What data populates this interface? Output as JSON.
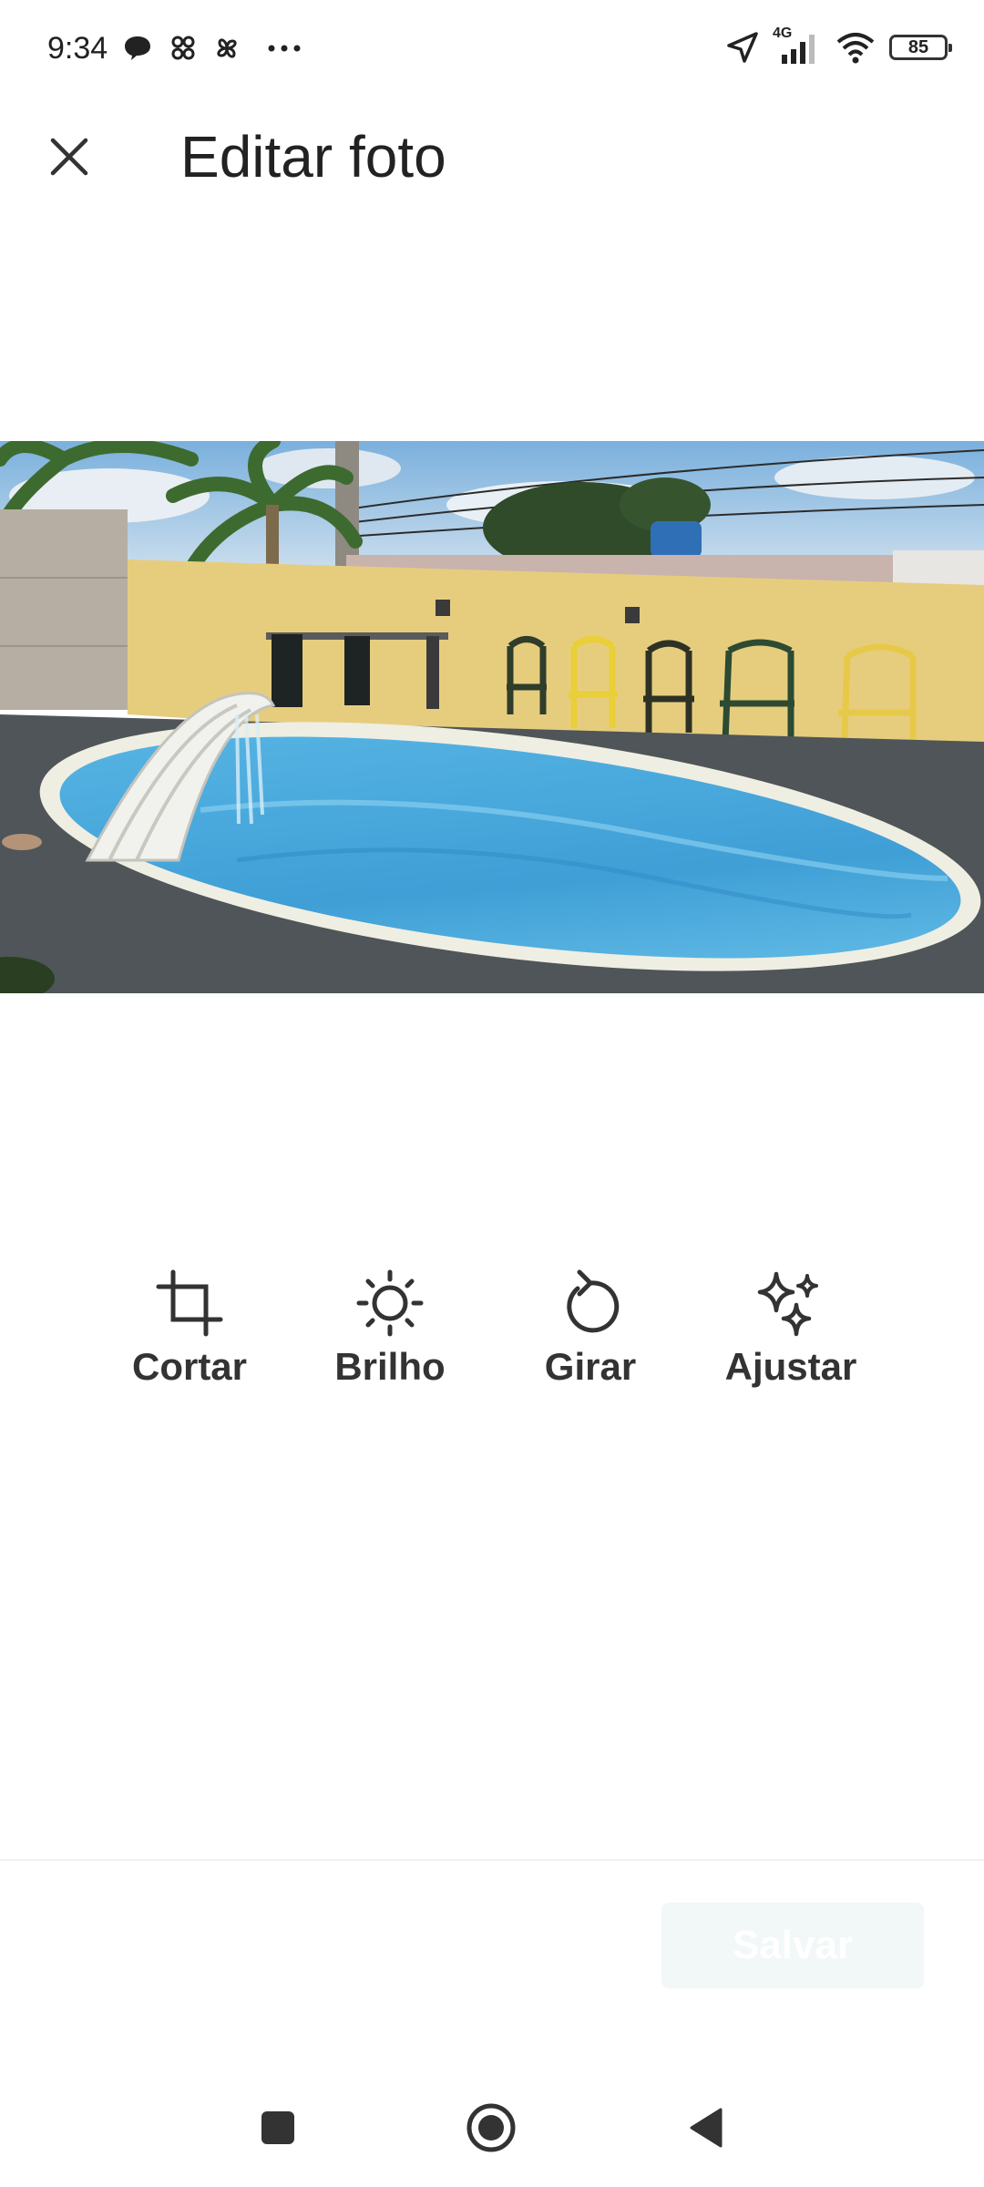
{
  "status_bar": {
    "time": "9:34",
    "network": "4G",
    "battery": "85",
    "notification_icons": [
      "chat-bubble-icon",
      "app-grid-icon",
      "pinwheel-icon",
      "more-dots-icon"
    ]
  },
  "header": {
    "title": "Editar foto",
    "close_icon": "close-icon"
  },
  "photo": {
    "subject": "pool-courtyard-photo"
  },
  "tools": [
    {
      "label": "Cortar",
      "icon": "crop-icon"
    },
    {
      "label": "Brilho",
      "icon": "brightness-icon"
    },
    {
      "label": "Girar",
      "icon": "rotate-icon"
    },
    {
      "label": "Ajustar",
      "icon": "sparkles-icon"
    }
  ],
  "footer": {
    "save_label": "Salvar",
    "save_enabled": false
  },
  "nav_bar": {
    "buttons": [
      "recents-square-icon",
      "home-circle-icon",
      "back-triangle-icon"
    ]
  },
  "colors": {
    "text": "#222222",
    "save_disabled_bg": "#f1f8f7",
    "pool_water": "#4aa8d8",
    "wall_yellow": "#e6cd7e"
  }
}
